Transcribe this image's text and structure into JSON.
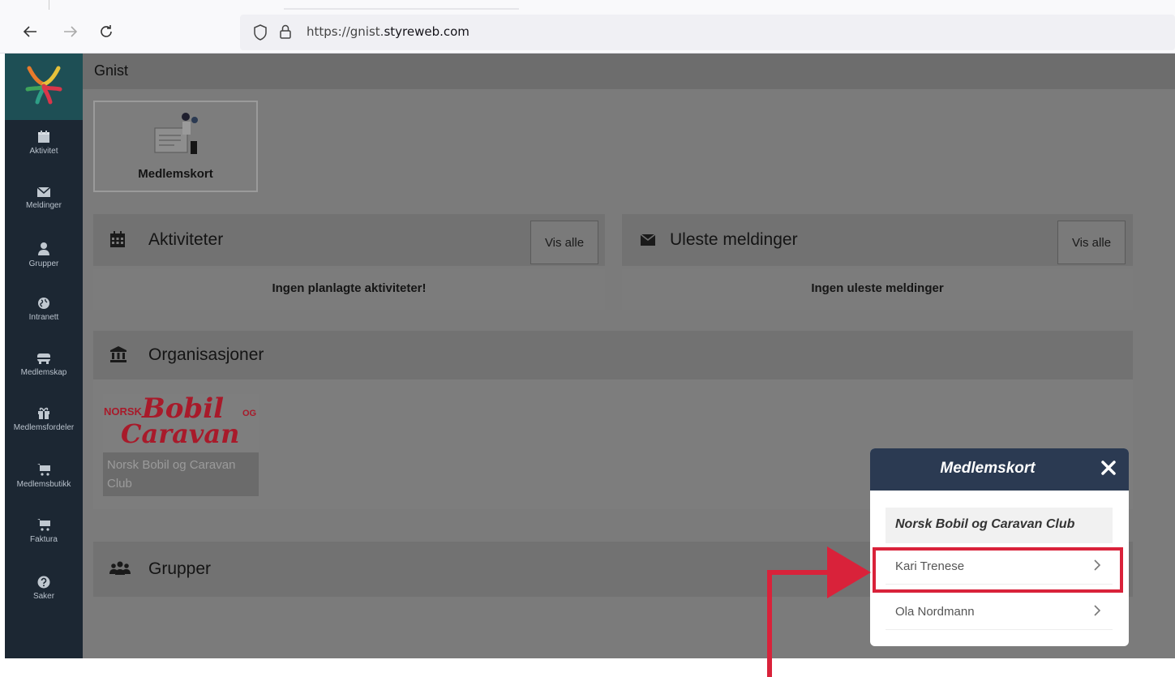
{
  "browser": {
    "url_prefix": "https://gnist.",
    "url_domain": "styreweb.com"
  },
  "app": {
    "title": "Gnist"
  },
  "sidebar": {
    "items": [
      {
        "label": "Aktivitet",
        "icon": "calendar-icon"
      },
      {
        "label": "Meldinger",
        "icon": "envelope-icon"
      },
      {
        "label": "Grupper",
        "icon": "user-icon"
      },
      {
        "label": "Intranett",
        "icon": "globe-icon"
      },
      {
        "label": "Medlemskap",
        "icon": "membership-icon"
      },
      {
        "label": "Medlemsfordeler",
        "icon": "gift-icon"
      },
      {
        "label": "Medlemsbutikk",
        "icon": "cart-icon"
      },
      {
        "label": "Faktura",
        "icon": "cart-icon"
      },
      {
        "label": "Saker",
        "icon": "question-icon"
      }
    ]
  },
  "card_tile": {
    "label": "Medlemskort"
  },
  "panels": {
    "activities": {
      "title": "Aktiviteter",
      "button": "Vis alle",
      "message": "Ingen planlagte aktiviteter!"
    },
    "messages": {
      "title": "Uleste meldinger",
      "button": "Vis alle",
      "message": "Ingen uleste meldinger"
    },
    "organizations": {
      "title": "Organisasjoner",
      "org_name": "Norsk Bobil og Caravan Club",
      "logo_text_small": "NORSK",
      "logo_text_main": "Bobil",
      "logo_text_og": "OG",
      "logo_text_second": "Caravan"
    },
    "groups": {
      "title": "Grupper"
    }
  },
  "modal": {
    "title": "Medlemskort",
    "organization": "Norsk Bobil og Caravan Club",
    "members": [
      "Kari Trenese",
      "Ola Nordmann"
    ]
  },
  "colors": {
    "sidebar": "#1c2733",
    "modal_header": "#2b3a52",
    "annotation": "#d9223a"
  }
}
